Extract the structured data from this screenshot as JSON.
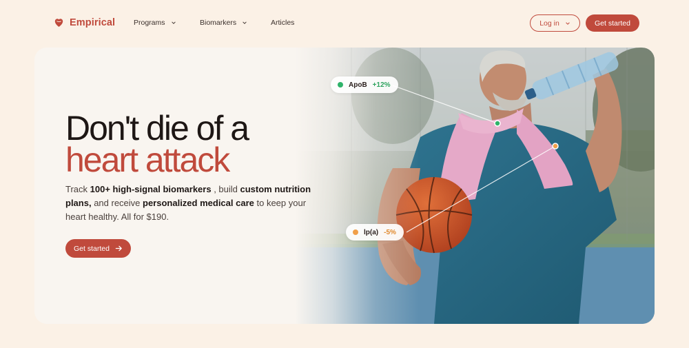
{
  "brand": {
    "name": "Empirical",
    "logo_icon": "heart-icon",
    "accent": "#c04a3c"
  },
  "nav": {
    "links": [
      {
        "label": "Programs",
        "has_dropdown": true
      },
      {
        "label": "Biomarkers",
        "has_dropdown": true
      },
      {
        "label": "Articles",
        "has_dropdown": false
      }
    ],
    "login_label": "Log in",
    "cta_label": "Get started"
  },
  "hero": {
    "headline_line1": "Don't die of a",
    "headline_line2": "heart attack",
    "sub": {
      "p1": "Track ",
      "b1": "100+ high-signal biomarkers",
      "p2": " , build ",
      "b2": "custom nutrition plans,",
      "p3": " and receive ",
      "b3": "personalized medical care",
      "p4": " to keep your heart healthy. All for $190."
    },
    "cta_label": "Get started",
    "cta_icon": "arrow-right-icon"
  },
  "markers": [
    {
      "name": "ApoB",
      "change": "+12%",
      "color": "#2fb36a",
      "change_color": "#2fa35f"
    },
    {
      "name": "lp(a)",
      "change": "-5%",
      "color": "#f0a04a",
      "change_color": "#e0892e"
    }
  ]
}
